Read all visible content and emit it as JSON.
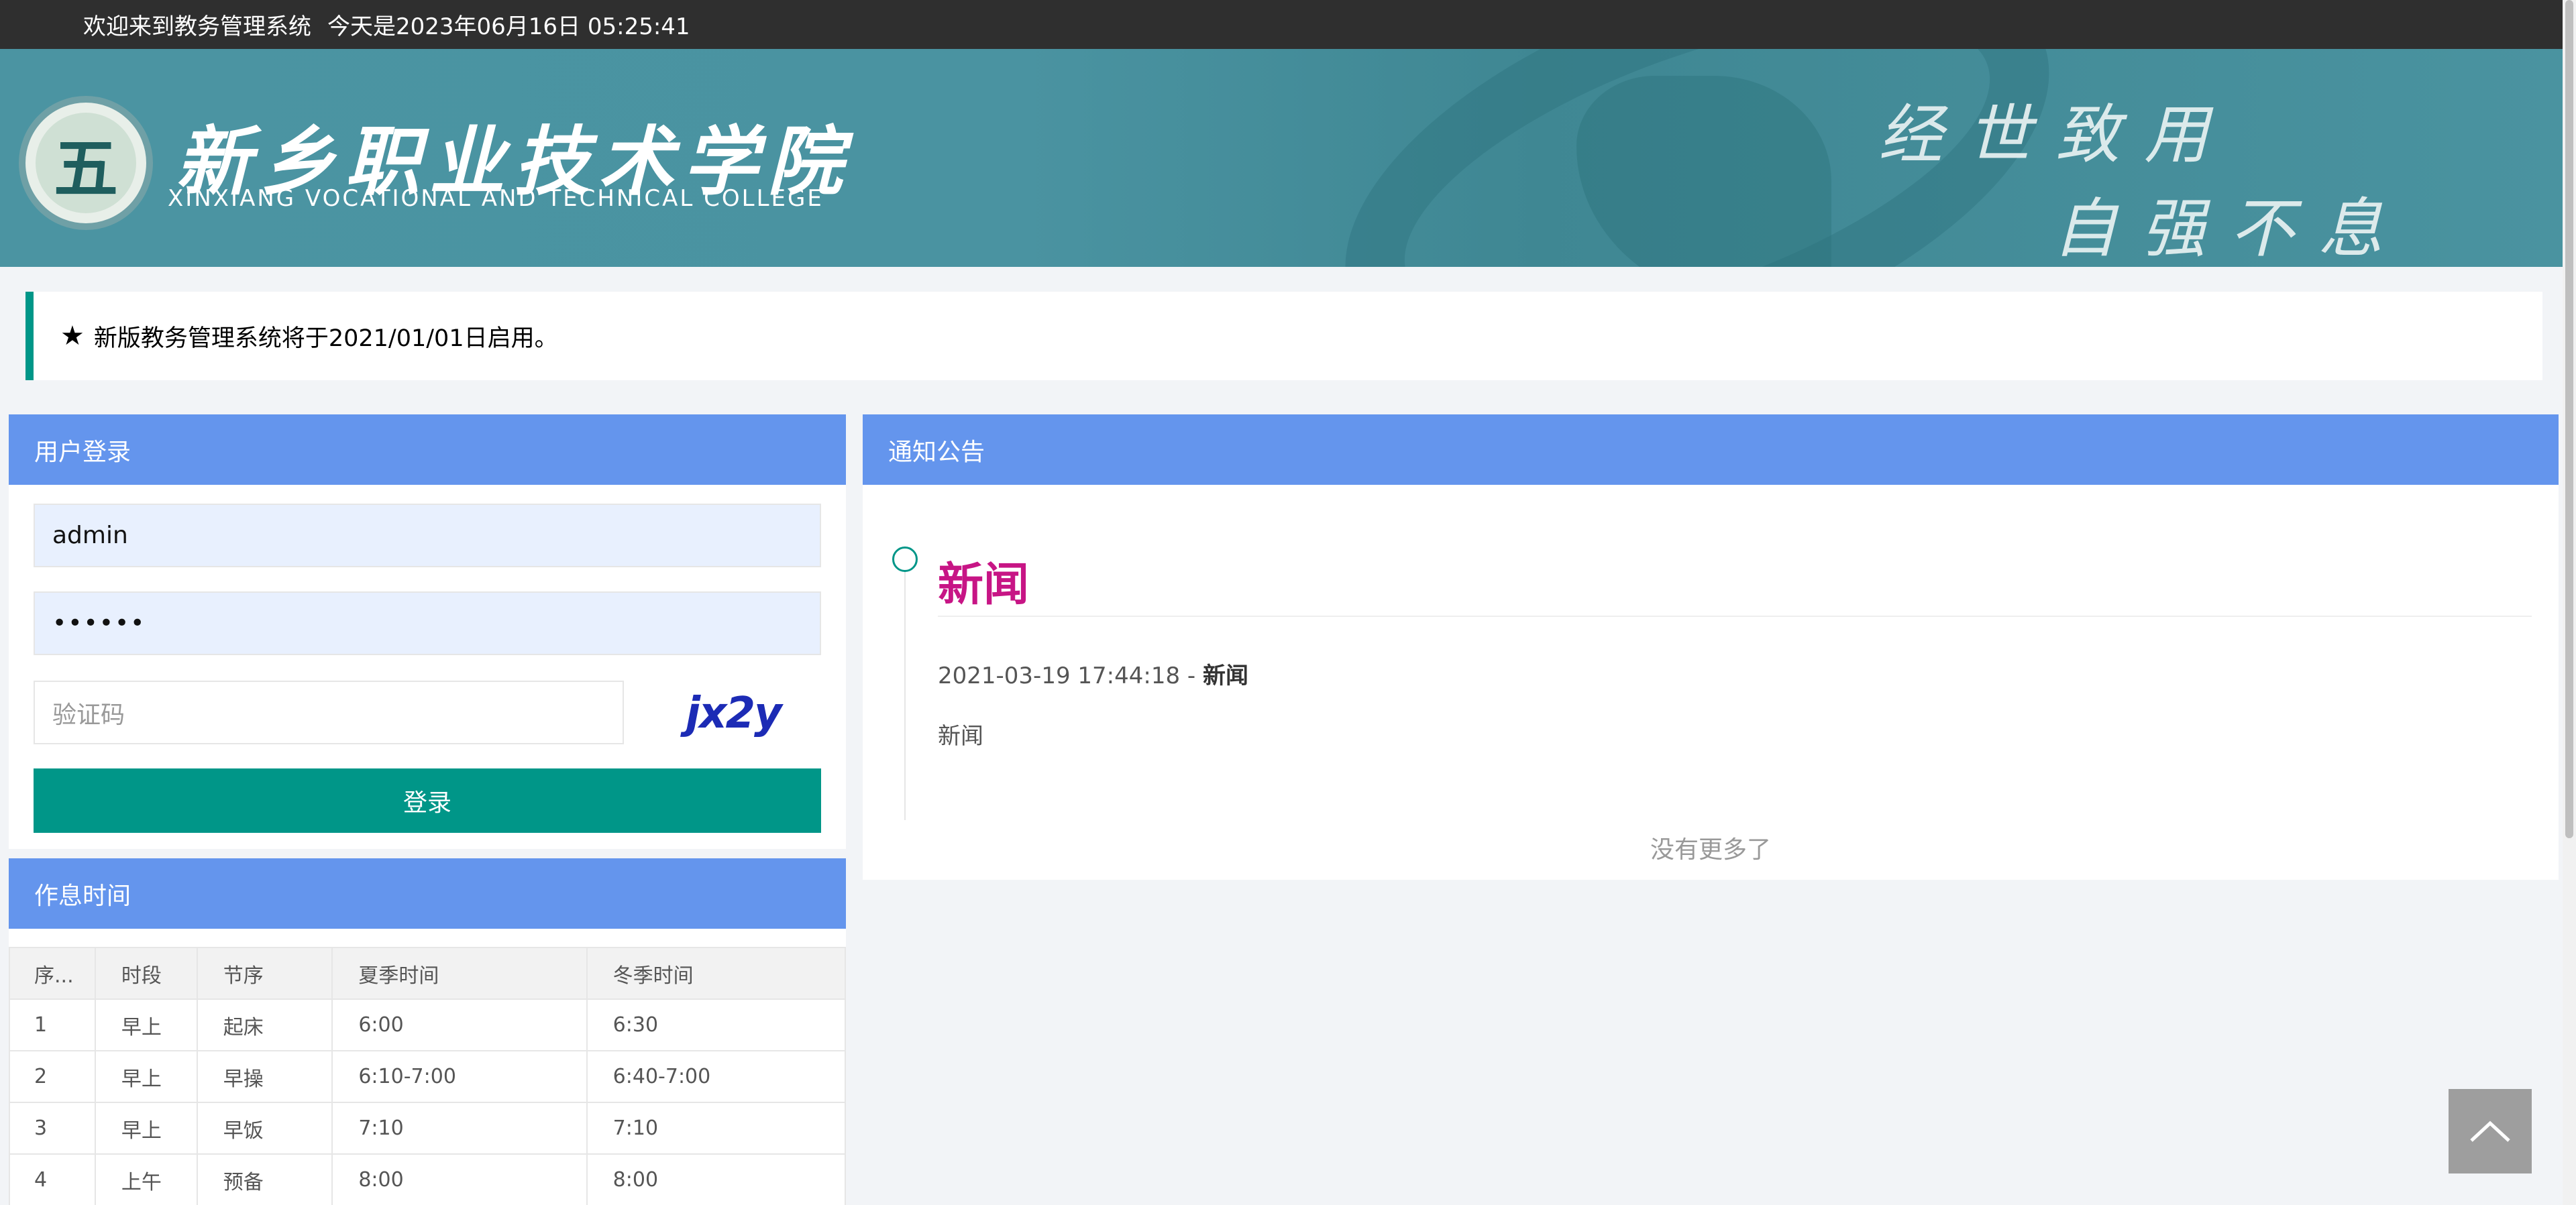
{
  "topbar": {
    "welcome": "欢迎来到教务管理系统",
    "date_text": "今天是2023年06月16日 05:25:41"
  },
  "banner": {
    "logo_glyph": "五",
    "college_cn": "新乡职业技术学院",
    "college_en": "XINXIANG VOCATIONAL AND TECHNICAL COLLEGE",
    "motto_line1": "经世致用",
    "motto_line2": "自强不息"
  },
  "notice": {
    "icon": "star-icon",
    "text": "新版教务管理系统将于2021/01/01日启用。"
  },
  "login": {
    "title": "用户登录",
    "username_value": "admin",
    "password_mask": "••••••",
    "captcha_placeholder": "验证码",
    "captcha_text": "jx2y",
    "submit_label": "登录"
  },
  "schedule": {
    "title": "作息时间",
    "columns": [
      "序...",
      "时段",
      "节序",
      "夏季时间",
      "冬季时间"
    ],
    "rows": [
      [
        "1",
        "早上",
        "起床",
        "6:00",
        "6:30"
      ],
      [
        "2",
        "早上",
        "早操",
        "6:10-7:00",
        "6:40-7:00"
      ],
      [
        "3",
        "早上",
        "早饭",
        "7:10",
        "7:10"
      ],
      [
        "4",
        "上午",
        "预备",
        "8:00",
        "8:00"
      ]
    ]
  },
  "news": {
    "title": "通知公告",
    "item_title": "新闻",
    "item_datetime": "2021-03-19 17:44:18",
    "item_separator": " - ",
    "item_category": "新闻",
    "item_body": "新闻",
    "no_more": "没有更多了"
  },
  "colors": {
    "accent": "#009688",
    "panel_header": "#6495ed",
    "news_title": "#c71585",
    "topbar": "#2f2f2f"
  }
}
